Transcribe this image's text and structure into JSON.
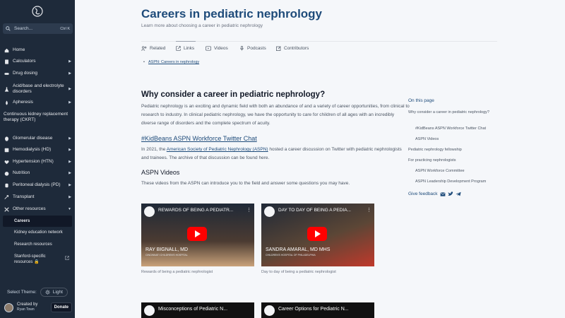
{
  "sidebar": {
    "search": {
      "placeholder": "Search...",
      "shortcut": "Ctrl K"
    },
    "items": [
      {
        "label": "Home",
        "icon": "home-icon",
        "arrow": ""
      },
      {
        "label": "Calculators",
        "icon": "calculator-icon",
        "arrow": "▶"
      },
      {
        "label": "Drug dosing",
        "icon": "pill-icon",
        "arrow": "▶"
      },
      {
        "label": "Acid/base and electrolyte disorders",
        "icon": "flask-icon",
        "arrow": "▶"
      },
      {
        "label": "Apheresis",
        "icon": "drop-icon",
        "arrow": "▶"
      },
      {
        "label": "Continuous kidney replacement therapy (CKRT)",
        "icon": "",
        "arrow": ""
      },
      {
        "label": "Glomerular disease",
        "icon": "kidney-icon",
        "arrow": "▶"
      },
      {
        "label": "Hemodialysis (HD)",
        "icon": "machine-icon",
        "arrow": "▶"
      },
      {
        "label": "Hypertension (HTN)",
        "icon": "heart-icon",
        "arrow": "▶"
      },
      {
        "label": "Nutrition",
        "icon": "apple-icon",
        "arrow": "▶"
      },
      {
        "label": "Peritoneal dialysis (PD)",
        "icon": "bag-icon",
        "arrow": "▶"
      },
      {
        "label": "Transplant",
        "icon": "transplant-icon",
        "arrow": "▶"
      },
      {
        "label": "Other resources",
        "icon": "tools-icon",
        "arrow": "▼"
      }
    ],
    "sub_items": [
      {
        "label": "Careers"
      },
      {
        "label": "Kidney education network"
      },
      {
        "label": "Research resources"
      },
      {
        "label": "Stanford-specific resources 🔒"
      }
    ],
    "theme_label": "Select Theme:",
    "theme_value": "Light",
    "creator": {
      "label": "Created by",
      "name": "Ryan Town"
    },
    "donate": "Donate"
  },
  "page": {
    "title": "Careers in pediatric nephrology",
    "subtitle": "Learn more about choosing a career in pediatric nephrology",
    "tabs": [
      {
        "label": "Related"
      },
      {
        "label": "Links"
      },
      {
        "label": "Videos"
      },
      {
        "label": "Podcasts"
      },
      {
        "label": "Contributors"
      }
    ],
    "links": [
      "ASPN: Careers in nephrology"
    ],
    "section_title": "Why consider a career in pediatric nephrology?",
    "intro": "Pediatric nephrology is an exciting and dynamic field with both an abundance of and a variety of career opportunities, from clinical to research to industry. In clinical pediatric nephrology, we have the opportunity to care for children of all ages with an incredibly diverse range of disorders and the complete spectrum of acuity.",
    "hashtag": "#KidBeans ASPN Workforce Twitter Chat",
    "chat_pre": "In 2021, the ",
    "chat_link": "American Society of Pediatric Nephrology (ASPN)",
    "chat_post": " hosted a career discussion on Twitter with pediatric nephrologists and trainees. The archive of that discussion can be found here.",
    "videos_title": "ASPN Videos",
    "videos_intro": "These videos from the ASPN can introduce you to the field and answer some questions you may have.",
    "videos": [
      {
        "title": "REWARDS OF BEING A PEDIATR...",
        "name": "RAY BIGNALL, MD",
        "org": "CINCINNATI CHILDREN'S HOSPITAL",
        "caption": "Rewards of being a pediatric nephrologist"
      },
      {
        "title": "DAY TO DAY OF BEING A PEDIA...",
        "name": "SANDRA AMARAL, MD MHS",
        "org": "CHILDREN'S HOSPITAL OF PHILADELPHIA",
        "caption": "Day to day of being a pediatric nephrologist"
      },
      {
        "title": "Misconceptions of Pediatric N...",
        "name": "",
        "org": "",
        "caption": ""
      },
      {
        "title": "Career Options for Pediatric N...",
        "name": "",
        "org": "",
        "caption": ""
      }
    ]
  },
  "toc": {
    "heading": "On this page",
    "items": [
      "Why consider a career in pediatric nephrology?",
      "#KidBeans ASPN Workforce Twitter Chat",
      "ASPN Videos",
      "Pediatric nephrology fellowship",
      "For practicing nephrologists",
      "ASPN Workforce Committee",
      "ASPN Leadership Development Program"
    ],
    "feedback": "Give feedback"
  },
  "colors": {
    "sidebar_bg": "#1e2a3a",
    "accent": "#1e4b7a",
    "youtube_red": "#ff0000"
  }
}
